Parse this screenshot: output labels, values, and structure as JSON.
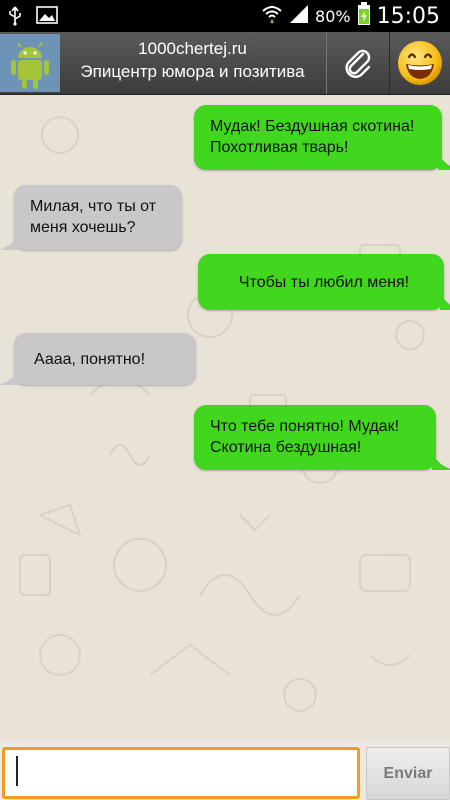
{
  "status_bar": {
    "battery_percent": "80%",
    "time": "15:05",
    "icons": [
      "usb-icon",
      "image-icon",
      "wifi-icon",
      "signal-icon",
      "battery-icon"
    ]
  },
  "header": {
    "title": "1000chertej.ru",
    "subtitle": "Эпицентр юмора и позитива",
    "avatar_icon": "android-icon",
    "attach_icon": "paperclip-icon",
    "emoji_icon": "smiley-icon"
  },
  "messages": [
    {
      "side": "out",
      "text": "Мудак! Бездушная скотина!\nПохотливая тварь!"
    },
    {
      "side": "in",
      "text": "Милая, что ты от\nменя хочешь?"
    },
    {
      "side": "out",
      "text": "Чтобы ты любил меня!"
    },
    {
      "side": "in",
      "text": "Аааа, понятно!"
    },
    {
      "side": "out",
      "text": "Что тебе понятно! Мудак!\nСкотина бездушная!"
    }
  ],
  "composer": {
    "placeholder": "",
    "send_label": "Enviar"
  },
  "colors": {
    "outgoing_bubble": "#41d71f",
    "incoming_bubble": "#c9c7c9",
    "input_focus": "#f29a23"
  }
}
